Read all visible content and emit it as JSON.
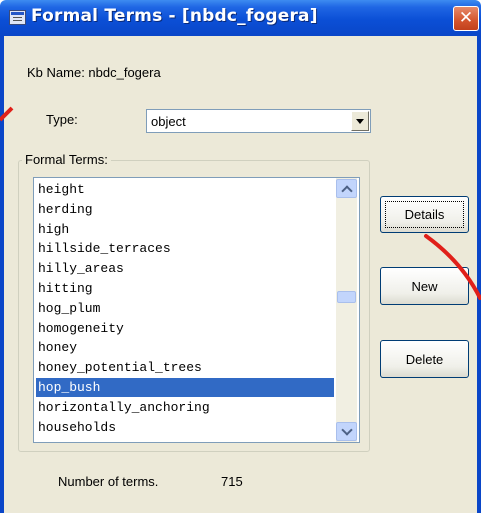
{
  "window": {
    "title": "Formal Terms - [nbdc_fogera]",
    "close_glyph": "✕"
  },
  "kb_name": "Kb Name: nbdc_fogera",
  "type_field": {
    "label": "Type:",
    "value": "object"
  },
  "group": {
    "legend": "Formal Terms:"
  },
  "terms": [
    {
      "text": "height",
      "selected": false
    },
    {
      "text": "herding",
      "selected": false
    },
    {
      "text": "high",
      "selected": false
    },
    {
      "text": "hillside_terraces",
      "selected": false
    },
    {
      "text": "hilly_areas",
      "selected": false
    },
    {
      "text": "hitting",
      "selected": false
    },
    {
      "text": "hog_plum",
      "selected": false
    },
    {
      "text": "homogeneity",
      "selected": false
    },
    {
      "text": "honey",
      "selected": false
    },
    {
      "text": "honey_potential_trees",
      "selected": false
    },
    {
      "text": "hop_bush",
      "selected": true
    },
    {
      "text": "horizontally_anchoring",
      "selected": false
    },
    {
      "text": "households",
      "selected": false
    }
  ],
  "buttons": {
    "details": "Details",
    "new": "New",
    "delete": "Delete"
  },
  "count": {
    "label": "Number of terms.",
    "value": "715"
  },
  "colors": {
    "titlebar": "#0a46c8",
    "selection": "#316ac5",
    "annotation": "#e0201a"
  }
}
